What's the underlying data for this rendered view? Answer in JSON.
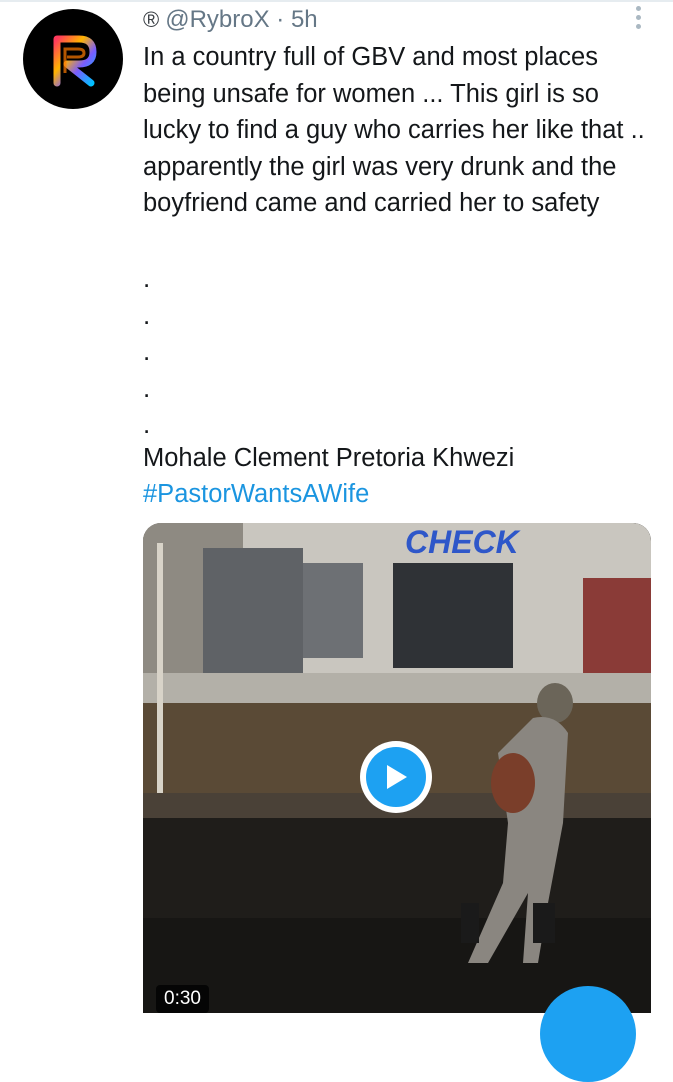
{
  "tweet": {
    "registered_mark": "®",
    "handle": "@RybroX",
    "separator": "·",
    "time": "5h",
    "text": "In a country full of GBV and most places being unsafe for women ... This girl is so lucky to find a guy who carries her like that .. apparently the girl was very drunk and the boyfriend came and carried her to safety",
    "dots": [
      ".",
      ".",
      ".",
      ".",
      "."
    ],
    "credit": "Mohale Clement Pretoria Khwezi",
    "hashtag": "#PastorWantsAWife",
    "avatar_letter": "R",
    "more_icon": "vertical-ellipsis-icon"
  },
  "media": {
    "type": "video",
    "sign_text": "CHECK",
    "duration": "0:30",
    "play_icon": "play-icon"
  },
  "colors": {
    "link": "#1b95e0",
    "play": "#1da1f2",
    "text": "#14171a",
    "meta": "#657786"
  }
}
